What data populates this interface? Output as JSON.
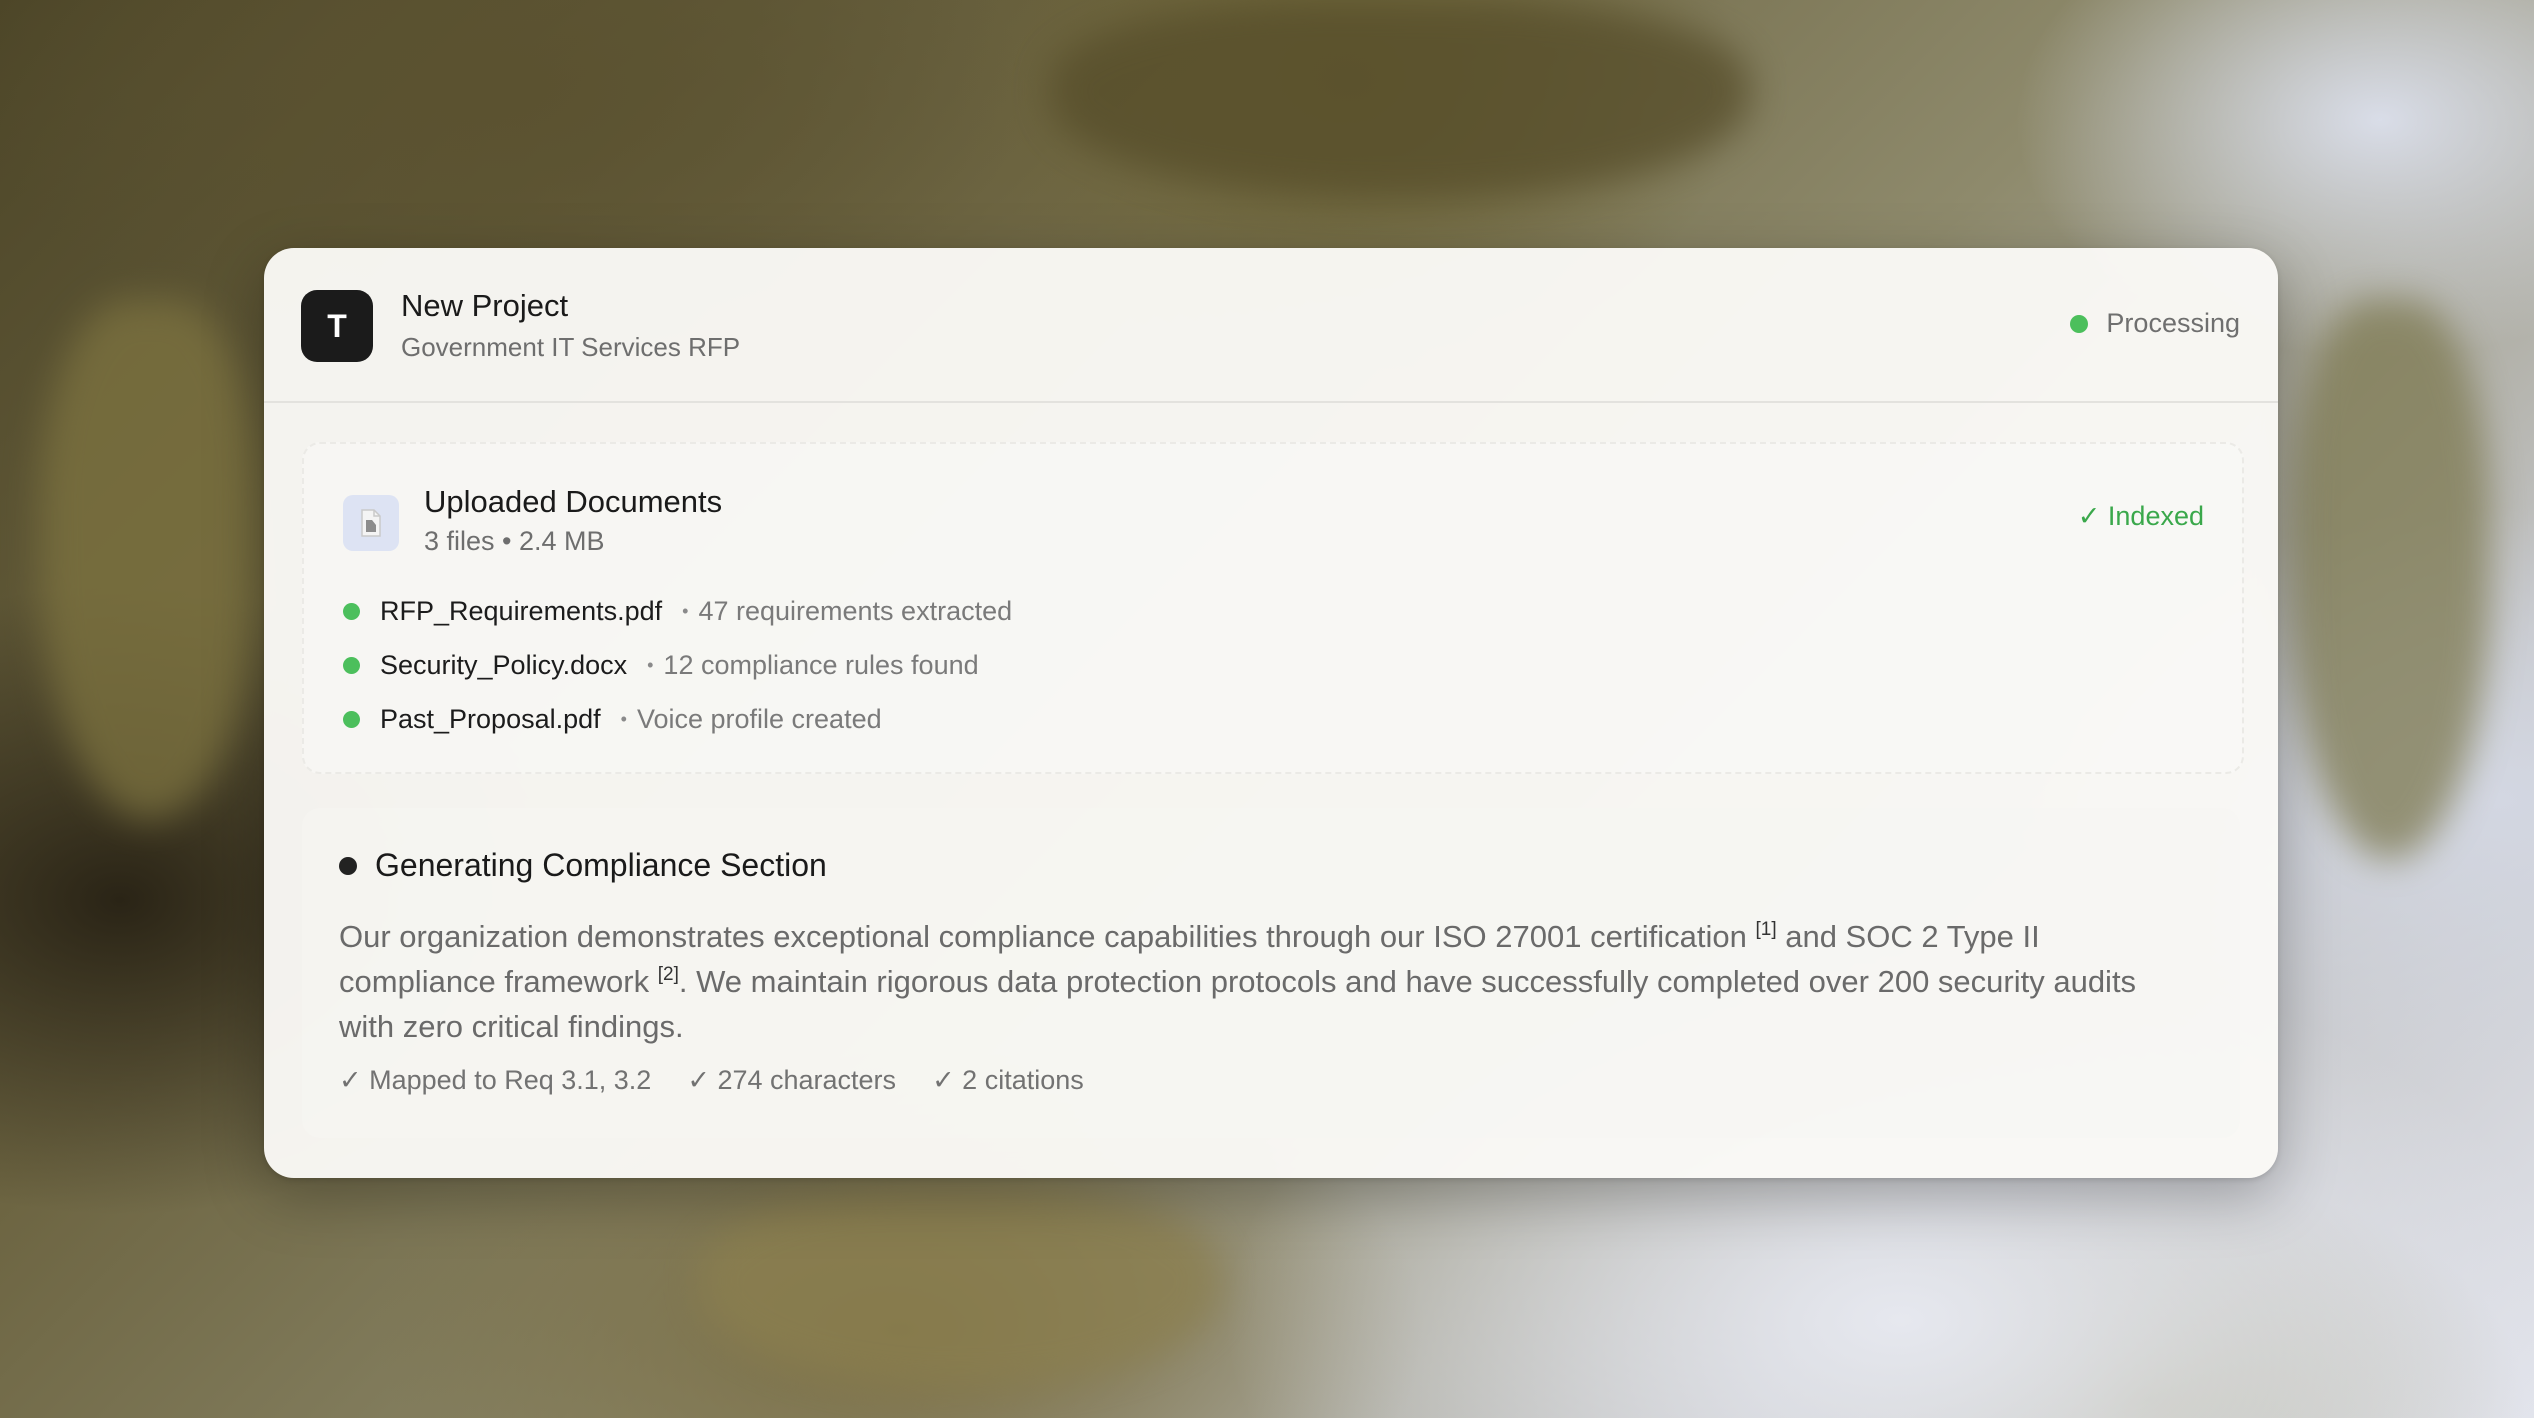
{
  "project": {
    "avatar_letter": "T",
    "title": "New Project",
    "subtitle": "Government IT Services RFP",
    "status": "Processing",
    "status_color": "#4cbf5c"
  },
  "documents": {
    "icon": "document-icon",
    "title": "Uploaded Documents",
    "meta": "3 files • 2.4 MB",
    "indexed": "✓ Indexed",
    "indexed_color": "#3aa84b",
    "separator": "•",
    "files": [
      {
        "name": "RFP_Requirements.pdf",
        "detail": "47 requirements extracted"
      },
      {
        "name": "Security_Policy.docx",
        "detail": "12 compliance rules found"
      },
      {
        "name": "Past_Proposal.pdf",
        "detail": "Voice profile created"
      }
    ]
  },
  "generation": {
    "title": "Generating Compliance Section",
    "text_part1": "Our organization demonstrates exceptional compliance capabilities through our ISO 27001 certification",
    "citation1": "[1]",
    "text_part2": " and SOC 2 Type II compliance framework",
    "citation2": "[2]",
    "text_part3": ". We maintain rigorous data protection protocols and have successfully completed over 200 security audits with zero critical findings.",
    "checks": [
      "✓ Mapped to Req 3.1, 3.2",
      "✓ 274 characters",
      "✓ 2 citations"
    ]
  }
}
